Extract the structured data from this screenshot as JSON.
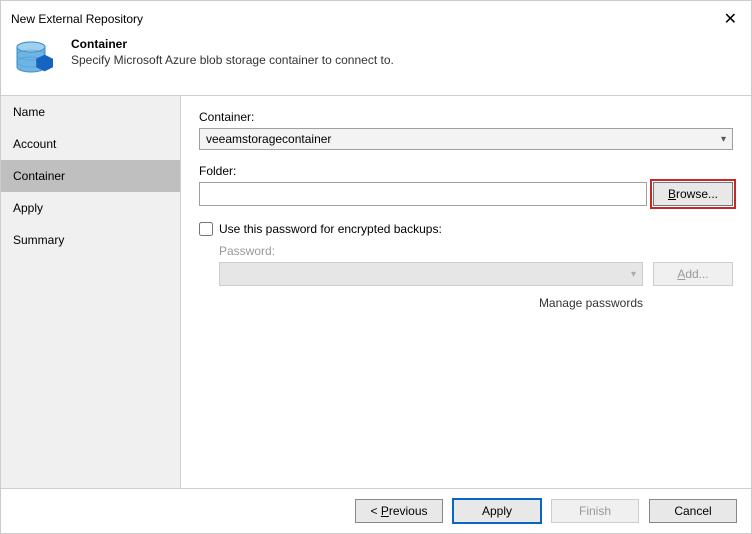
{
  "window": {
    "title": "New External Repository"
  },
  "header": {
    "title": "Container",
    "description": "Specify Microsoft Azure blob storage container to connect to."
  },
  "sidebar": {
    "items": [
      {
        "label": "Name"
      },
      {
        "label": "Account"
      },
      {
        "label": "Container"
      },
      {
        "label": "Apply"
      },
      {
        "label": "Summary"
      }
    ]
  },
  "content": {
    "container_label": "Container:",
    "container_value": "veeamstoragecontainer",
    "folder_label": "Folder:",
    "folder_value": "",
    "browse_label": "Browse...",
    "encrypt_checkbox_label": "Use this password for encrypted backups:",
    "password_label": "Password:",
    "add_label": "Add...",
    "manage_label": "Manage passwords"
  },
  "footer": {
    "previous": "< Previous",
    "apply": "Apply",
    "finish": "Finish",
    "cancel": "Cancel"
  }
}
